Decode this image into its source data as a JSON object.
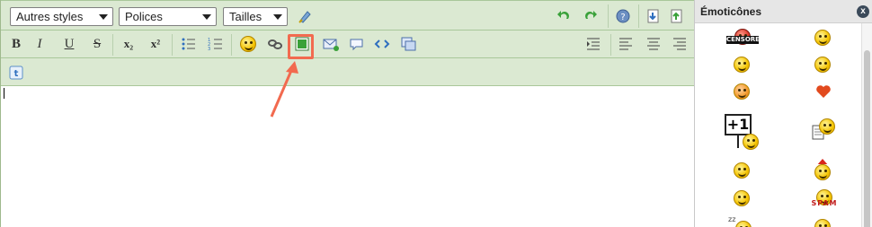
{
  "toolbar": {
    "styles_select": "Autres styles",
    "fonts_select": "Polices",
    "sizes_select": "Tailles"
  },
  "format": {
    "bold": "B",
    "italic": "I",
    "underline": "U",
    "strike": "S",
    "subscript": "x₂",
    "superscript": "x²"
  },
  "panel": {
    "title": "Émoticônes",
    "close": "x",
    "plus_one": "+1",
    "censored": "CENSORED",
    "spam": "SPAM"
  },
  "colors": {
    "toolbar_bg": "#dbe9d2",
    "annotation": "#f26a4f",
    "icon_green": "#3aa13a",
    "icon_blue": "#2f6fbf"
  }
}
